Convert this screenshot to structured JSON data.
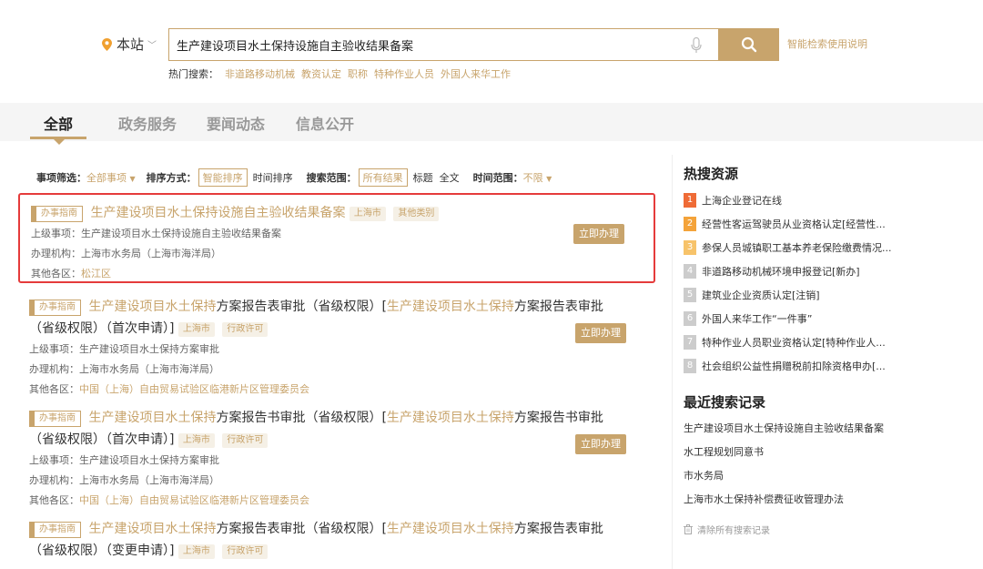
{
  "search": {
    "location": "本站",
    "query": "生产建设项目水土保持设施自主验收结果备案",
    "help_link": "智能检索使用说明",
    "hot_label": "热门搜索：",
    "hot_items": [
      "非道路移动机械",
      "教资认定",
      "职称",
      "特种作业人员",
      "外国人来华工作"
    ]
  },
  "tabs": [
    "全部",
    "政务服务",
    "要闻动态",
    "信息公开"
  ],
  "filters": {
    "item_filter_label": "事项筛选：",
    "item_filter_value": "全部事项",
    "sort_label": "排序方式：",
    "sort_smart": "智能排序",
    "sort_time": "时间排序",
    "scope_label": "搜索范围：",
    "scope_all": "所有结果",
    "scope_title": "标题",
    "scope_full": "全文",
    "time_label": "时间范围：",
    "time_value": "不限"
  },
  "labels": {
    "type_tag": "办事指南",
    "parent": "上级事项：",
    "agency": "办理机构：",
    "other_district": "其他各区：",
    "go_button": "立即办理"
  },
  "results": [
    {
      "title": "生产建设项目水土保持设施自主验收结果备案",
      "tag_city": "上海市",
      "tag_kind": "其他类别",
      "parent": "生产建设项目水土保持设施自主验收结果备案",
      "agency": "上海市水务局（上海市海洋局）",
      "district": "松江区"
    },
    {
      "title_a": "生产建设项目水土保持",
      "title_b": "方案报告表审批（省级权限）[",
      "title_c": "生产建设项目水土保持",
      "title_d": "方案报告表审批（省级权限）（首次申请）]",
      "tag_city": "上海市",
      "tag_kind": "行政许可",
      "parent": "生产建设项目水土保持方案审批",
      "agency": "上海市水务局（上海市海洋局）",
      "district": "中国（上海）自由贸易试验区临港新片区管理委员会"
    },
    {
      "title_a": "生产建设项目水土保持",
      "title_b": "方案报告书审批（省级权限）[",
      "title_c": "生产建设项目水土保持",
      "title_d": "方案报告书审批（省级权限）（首次申请）]",
      "tag_city": "上海市",
      "tag_kind": "行政许可",
      "parent": "生产建设项目水土保持方案审批",
      "agency": "上海市水务局（上海市海洋局）",
      "district": "中国（上海）自由贸易试验区临港新片区管理委员会"
    },
    {
      "title_a": "生产建设项目水土保持",
      "title_b": "方案报告表审批（省级权限）[",
      "title_c": "生产建设项目水土保持",
      "title_d": "方案报告表审批（省级权限）（变更申请）]",
      "tag_city": "上海市",
      "tag_kind": "行政许可"
    }
  ],
  "sidebar": {
    "hot_title": "热搜资源",
    "hot": [
      {
        "rank": "1",
        "text": "上海企业登记在线"
      },
      {
        "rank": "2",
        "text": "经营性客运驾驶员从业资格认定[经营性..."
      },
      {
        "rank": "3",
        "text": "参保人员城镇职工基本养老保险缴费情况..."
      },
      {
        "rank": "4",
        "text": "非道路移动机械环境申报登记[新办]"
      },
      {
        "rank": "5",
        "text": "建筑业企业资质认定[注销]"
      },
      {
        "rank": "6",
        "text": "外国人来华工作“一件事”"
      },
      {
        "rank": "7",
        "text": "特种作业人员职业资格认定[特种作业人..."
      },
      {
        "rank": "8",
        "text": "社会组织公益性捐赠税前扣除资格申办[..."
      }
    ],
    "recent_title": "最近搜索记录",
    "recent": [
      "生产建设项目水土保持设施自主验收结果备案",
      "水工程规划同意书",
      "市水务局",
      "上海市水土保持补偿费征收管理办法"
    ],
    "clear_label": "清除所有搜索记录"
  },
  "colors": {
    "accent": "#c8a46c",
    "highlight_border": "#e53b3b"
  }
}
